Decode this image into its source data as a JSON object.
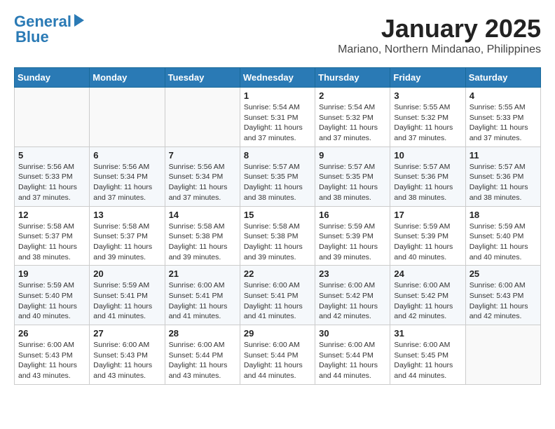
{
  "header": {
    "logo_line1": "General",
    "logo_line2": "Blue",
    "month": "January 2025",
    "location": "Mariano, Northern Mindanao, Philippines"
  },
  "weekdays": [
    "Sunday",
    "Monday",
    "Tuesday",
    "Wednesday",
    "Thursday",
    "Friday",
    "Saturday"
  ],
  "weeks": [
    [
      {
        "day": "",
        "info": ""
      },
      {
        "day": "",
        "info": ""
      },
      {
        "day": "",
        "info": ""
      },
      {
        "day": "1",
        "info": "Sunrise: 5:54 AM\nSunset: 5:31 PM\nDaylight: 11 hours\nand 37 minutes."
      },
      {
        "day": "2",
        "info": "Sunrise: 5:54 AM\nSunset: 5:32 PM\nDaylight: 11 hours\nand 37 minutes."
      },
      {
        "day": "3",
        "info": "Sunrise: 5:55 AM\nSunset: 5:32 PM\nDaylight: 11 hours\nand 37 minutes."
      },
      {
        "day": "4",
        "info": "Sunrise: 5:55 AM\nSunset: 5:33 PM\nDaylight: 11 hours\nand 37 minutes."
      }
    ],
    [
      {
        "day": "5",
        "info": "Sunrise: 5:56 AM\nSunset: 5:33 PM\nDaylight: 11 hours\nand 37 minutes."
      },
      {
        "day": "6",
        "info": "Sunrise: 5:56 AM\nSunset: 5:34 PM\nDaylight: 11 hours\nand 37 minutes."
      },
      {
        "day": "7",
        "info": "Sunrise: 5:56 AM\nSunset: 5:34 PM\nDaylight: 11 hours\nand 37 minutes."
      },
      {
        "day": "8",
        "info": "Sunrise: 5:57 AM\nSunset: 5:35 PM\nDaylight: 11 hours\nand 38 minutes."
      },
      {
        "day": "9",
        "info": "Sunrise: 5:57 AM\nSunset: 5:35 PM\nDaylight: 11 hours\nand 38 minutes."
      },
      {
        "day": "10",
        "info": "Sunrise: 5:57 AM\nSunset: 5:36 PM\nDaylight: 11 hours\nand 38 minutes."
      },
      {
        "day": "11",
        "info": "Sunrise: 5:57 AM\nSunset: 5:36 PM\nDaylight: 11 hours\nand 38 minutes."
      }
    ],
    [
      {
        "day": "12",
        "info": "Sunrise: 5:58 AM\nSunset: 5:37 PM\nDaylight: 11 hours\nand 38 minutes."
      },
      {
        "day": "13",
        "info": "Sunrise: 5:58 AM\nSunset: 5:37 PM\nDaylight: 11 hours\nand 39 minutes."
      },
      {
        "day": "14",
        "info": "Sunrise: 5:58 AM\nSunset: 5:38 PM\nDaylight: 11 hours\nand 39 minutes."
      },
      {
        "day": "15",
        "info": "Sunrise: 5:58 AM\nSunset: 5:38 PM\nDaylight: 11 hours\nand 39 minutes."
      },
      {
        "day": "16",
        "info": "Sunrise: 5:59 AM\nSunset: 5:39 PM\nDaylight: 11 hours\nand 39 minutes."
      },
      {
        "day": "17",
        "info": "Sunrise: 5:59 AM\nSunset: 5:39 PM\nDaylight: 11 hours\nand 40 minutes."
      },
      {
        "day": "18",
        "info": "Sunrise: 5:59 AM\nSunset: 5:40 PM\nDaylight: 11 hours\nand 40 minutes."
      }
    ],
    [
      {
        "day": "19",
        "info": "Sunrise: 5:59 AM\nSunset: 5:40 PM\nDaylight: 11 hours\nand 40 minutes."
      },
      {
        "day": "20",
        "info": "Sunrise: 5:59 AM\nSunset: 5:41 PM\nDaylight: 11 hours\nand 41 minutes."
      },
      {
        "day": "21",
        "info": "Sunrise: 6:00 AM\nSunset: 5:41 PM\nDaylight: 11 hours\nand 41 minutes."
      },
      {
        "day": "22",
        "info": "Sunrise: 6:00 AM\nSunset: 5:41 PM\nDaylight: 11 hours\nand 41 minutes."
      },
      {
        "day": "23",
        "info": "Sunrise: 6:00 AM\nSunset: 5:42 PM\nDaylight: 11 hours\nand 42 minutes."
      },
      {
        "day": "24",
        "info": "Sunrise: 6:00 AM\nSunset: 5:42 PM\nDaylight: 11 hours\nand 42 minutes."
      },
      {
        "day": "25",
        "info": "Sunrise: 6:00 AM\nSunset: 5:43 PM\nDaylight: 11 hours\nand 42 minutes."
      }
    ],
    [
      {
        "day": "26",
        "info": "Sunrise: 6:00 AM\nSunset: 5:43 PM\nDaylight: 11 hours\nand 43 minutes."
      },
      {
        "day": "27",
        "info": "Sunrise: 6:00 AM\nSunset: 5:43 PM\nDaylight: 11 hours\nand 43 minutes."
      },
      {
        "day": "28",
        "info": "Sunrise: 6:00 AM\nSunset: 5:44 PM\nDaylight: 11 hours\nand 43 minutes."
      },
      {
        "day": "29",
        "info": "Sunrise: 6:00 AM\nSunset: 5:44 PM\nDaylight: 11 hours\nand 44 minutes."
      },
      {
        "day": "30",
        "info": "Sunrise: 6:00 AM\nSunset: 5:44 PM\nDaylight: 11 hours\nand 44 minutes."
      },
      {
        "day": "31",
        "info": "Sunrise: 6:00 AM\nSunset: 5:45 PM\nDaylight: 11 hours\nand 44 minutes."
      },
      {
        "day": "",
        "info": ""
      }
    ]
  ]
}
